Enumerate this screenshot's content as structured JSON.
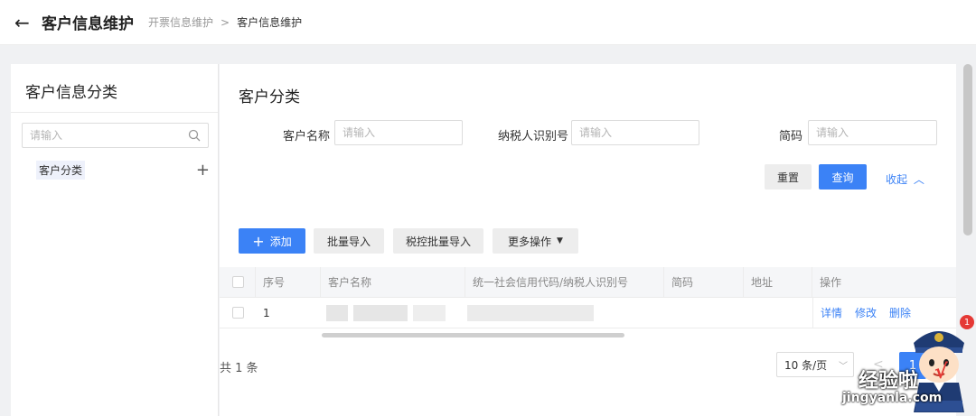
{
  "header": {
    "back_icon": "arrow-left-icon",
    "title": "客户信息维护",
    "breadcrumb": [
      "开票信息维护",
      "客户信息维护"
    ],
    "breadcrumb_sep": ">"
  },
  "sidebar": {
    "title": "客户信息分类",
    "search_placeholder": "请输入",
    "tree": [
      {
        "label": "客户分类"
      }
    ],
    "add_icon": "+"
  },
  "main": {
    "title": "客户分类",
    "filters": {
      "name_label": "客户名称",
      "name_placeholder": "请输入",
      "taxid_label": "纳税人识别号",
      "taxid_placeholder": "请输入",
      "short_label": "简码",
      "short_placeholder": "请输入"
    },
    "buttons": {
      "reset": "重置",
      "query": "查询",
      "collapse": "收起",
      "add": "添加",
      "batch_import": "批量导入",
      "tax_batch_import": "税控批量导入",
      "more": "更多操作"
    },
    "table": {
      "columns": [
        "序号",
        "客户名称",
        "统一社会信用代码/纳税人识别号",
        "简码",
        "地址",
        "操作"
      ],
      "rows": [
        {
          "index": "1",
          "actions": [
            "详情",
            "修改",
            "删除"
          ]
        }
      ]
    },
    "pagination": {
      "total": "共 1 条",
      "page_size": "10 条/页",
      "current_page": "1",
      "prev_icon": "<"
    }
  },
  "overlay": {
    "badge_count": "1",
    "watermark_cn": "经验啦",
    "watermark_en": "jingyanla.com",
    "check": "√"
  },
  "colors": {
    "primary": "#3b82f6",
    "background": "#f0f1f3",
    "badge": "#e53935"
  }
}
